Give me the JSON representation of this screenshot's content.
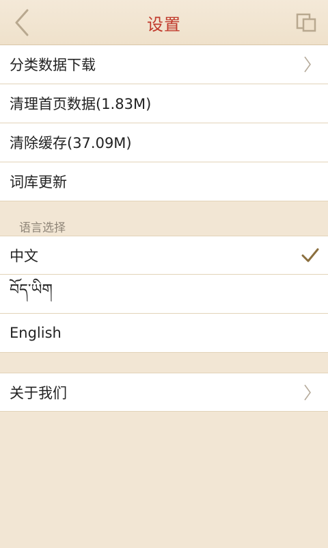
{
  "header": {
    "title": "设置",
    "back_icon": "chevron-left-icon",
    "action_icon": "copy-icon"
  },
  "data_group": {
    "items": [
      {
        "label": "分类数据下载",
        "has_chevron": true
      },
      {
        "label": "清理首页数据(1.83M)"
      },
      {
        "label": "清除缓存(37.09M)"
      },
      {
        "label": "词库更新"
      }
    ]
  },
  "language": {
    "section_label": "语言选择",
    "options": [
      {
        "label": "中文",
        "selected": true
      },
      {
        "label": "བོད་ཡིག",
        "selected": false
      },
      {
        "label": "English",
        "selected": false
      }
    ]
  },
  "about": {
    "label": "关于我们"
  },
  "colors": {
    "title": "#c0392b",
    "accent": "#8b6f3e",
    "background": "#f2e6d4"
  }
}
